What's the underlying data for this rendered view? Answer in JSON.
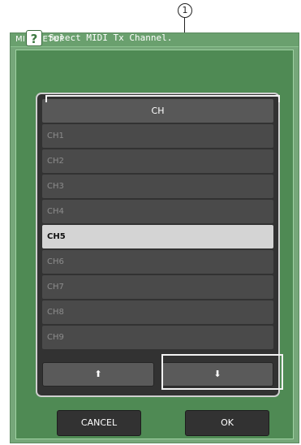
{
  "callout": {
    "number": "1"
  },
  "window": {
    "title": "MIDI SETUP"
  },
  "prompt": {
    "icon": "question-icon",
    "icon_glyph": "?",
    "text": "Select MIDI Tx Channel."
  },
  "channel_list": {
    "header": "CH",
    "items": [
      "CH1",
      "CH2",
      "CH3",
      "CH4",
      "CH5",
      "CH6",
      "CH7",
      "CH8",
      "CH9"
    ],
    "selected": "CH5"
  },
  "scroll": {
    "up_icon": "arrow-up-icon",
    "up_glyph": "⬆",
    "down_icon": "arrow-down-icon",
    "down_glyph": "⬇"
  },
  "buttons": {
    "cancel": "CANCEL",
    "ok": "OK"
  },
  "colors": {
    "window_bg": "#76a77a",
    "list_bg": "#323232",
    "row_bg": "#4a4a4a",
    "row_selected_bg": "#d4d4d4"
  }
}
